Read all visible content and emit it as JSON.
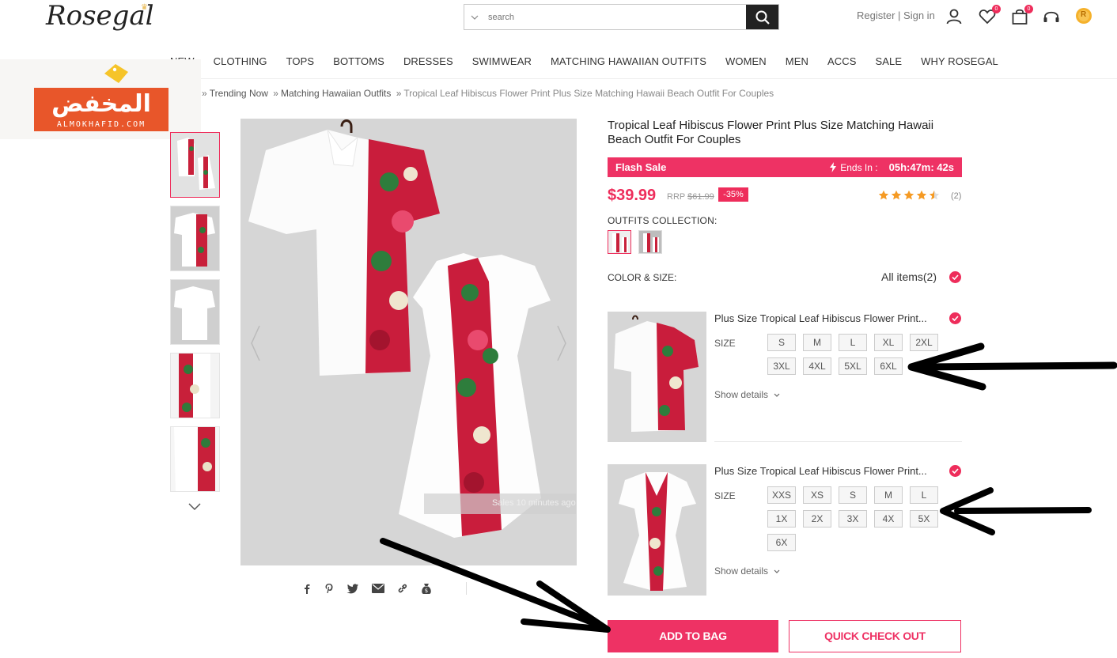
{
  "header": {
    "logo": "Rosegal",
    "search_placeholder": "search",
    "register_label": "Register",
    "sign_in_label": "Sign in",
    "wishlist_count": "0",
    "bag_count": "0",
    "coin_label": "R"
  },
  "nav": {
    "items": [
      "NEW",
      "CLOTHING",
      "TOPS",
      "BOTTOMS",
      "DRESSES",
      "SWIMWEAR",
      "MATCHING HAWAIIAN OUTFITS",
      "WOMEN",
      "MEN",
      "ACCS",
      "SALE",
      "WHY ROSEGAL"
    ]
  },
  "watermark": {
    "arabic": "المخفض",
    "latin": "ALMOKHAFID.COM"
  },
  "breadcrumb": {
    "items": [
      "Trending Now",
      "Matching Hawaiian Outfits"
    ],
    "current": "Tropical Leaf Hibiscus Flower Print Plus Size Matching Hawaii Beach Outfit For Couples",
    "separator": "»"
  },
  "product": {
    "title": "Tropical Leaf Hibiscus Flower Print Plus Size Matching Hawaii Beach Outfit For Couples",
    "flash_label": "Flash Sale",
    "ends_label": "Ends In :",
    "countdown": "05h:47m: 42s",
    "price": "$39.99",
    "rrp_label": "RRP",
    "rrp_price": "$61.99",
    "discount": "-35%",
    "rating": 4.5,
    "review_count": "(2)",
    "collection_label": "OUTFITS COLLECTION:",
    "color_size_label": "COLOR & SIZE:",
    "all_items_label": "All items(2)",
    "items": [
      {
        "name": "Plus Size Tropical Leaf Hibiscus Flower Print...",
        "size_label": "SIZE",
        "sizes": [
          "S",
          "M",
          "L",
          "XL",
          "2XL",
          "3XL",
          "4XL",
          "5XL",
          "6XL"
        ],
        "show_details": "Show details"
      },
      {
        "name": "Plus Size Tropical Leaf Hibiscus Flower Print...",
        "size_label": "SIZE",
        "sizes": [
          "XXS",
          "XS",
          "S",
          "M",
          "L",
          "1X",
          "2X",
          "3X",
          "4X",
          "5X",
          "6X"
        ],
        "show_details": "Show details"
      }
    ],
    "add_to_bag": "ADD TO BAG",
    "quick_checkout": "QUICK CHECK OUT"
  },
  "image_overlay": "Sales 10 minutes ago",
  "colors": {
    "accent": "#ee2d5b",
    "flash_bg": "#ee3264",
    "watermark_orange": "#e8562a"
  }
}
